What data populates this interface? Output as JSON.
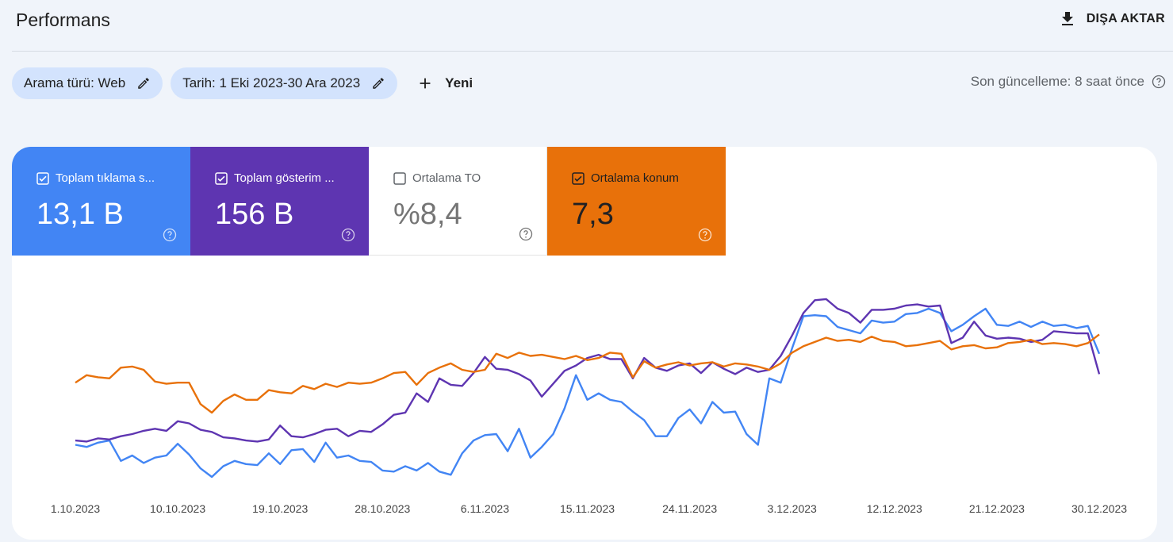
{
  "header": {
    "title": "Performans",
    "export_label": "DIŞA AKTAR"
  },
  "filters": {
    "search_type": "Arama türü: Web",
    "date": "Tarih: 1 Eki 2023-30 Ara 2023",
    "new_label": "Yeni",
    "last_update": "Son güncelleme: 8 saat önce"
  },
  "metrics": [
    {
      "label": "Toplam tıklama s...",
      "value": "13,1 B",
      "checked": true,
      "color": "#4285f4"
    },
    {
      "label": "Toplam gösterim ...",
      "value": "156 B",
      "checked": true,
      "color": "#5e35b1"
    },
    {
      "label": "Ortalama TO",
      "value": "%8,4",
      "checked": false,
      "color": "#ffffff"
    },
    {
      "label": "Ortalama konum",
      "value": "7,3",
      "checked": true,
      "color": "#e8710a"
    }
  ],
  "chart_data": {
    "type": "line",
    "x_tick_labels": [
      "1.10.2023",
      "10.10.2023",
      "19.10.2023",
      "28.10.2023",
      "6.11.2023",
      "15.11.2023",
      "24.11.2023",
      "3.12.2023",
      "12.12.2023",
      "21.12.2023",
      "30.12.2023"
    ],
    "x_count": 91,
    "y_axis_shown": false,
    "note_relative": "Series values are relative levels (0–1) read from the unlabelled chart; no y-axis is shown.",
    "series": [
      {
        "name": "Toplam tıklama sayısı",
        "color": "#4285f4",
        "values": [
          0.3,
          0.28,
          0.32,
          0.34,
          0.15,
          0.2,
          0.13,
          0.18,
          0.2,
          0.31,
          0.21,
          0.08,
          0.0,
          0.1,
          0.15,
          0.12,
          0.11,
          0.22,
          0.12,
          0.25,
          0.26,
          0.14,
          0.32,
          0.18,
          0.2,
          0.15,
          0.14,
          0.06,
          0.05,
          0.1,
          0.06,
          0.13,
          0.05,
          0.02,
          0.22,
          0.34,
          0.39,
          0.4,
          0.24,
          0.45,
          0.18,
          0.28,
          0.4,
          0.64,
          0.95,
          0.72,
          0.78,
          0.72,
          0.7,
          0.61,
          0.53,
          0.38,
          0.38,
          0.55,
          0.63,
          0.5,
          0.7,
          0.6,
          0.61,
          0.4,
          0.3,
          0.92,
          0.88,
          1.2,
          1.5,
          1.51,
          1.5,
          1.4,
          1.37,
          1.34,
          1.46,
          1.44,
          1.45,
          1.52,
          1.53,
          1.57,
          1.53,
          1.36,
          1.42,
          1.5,
          1.57,
          1.42,
          1.41,
          1.45,
          1.4,
          1.45,
          1.41,
          1.42,
          1.39,
          1.41,
          1.15
        ]
      },
      {
        "name": "Toplam gösterim sayısı",
        "color": "#5e35b1",
        "values": [
          0.34,
          0.33,
          0.36,
          0.35,
          0.38,
          0.4,
          0.43,
          0.45,
          0.43,
          0.52,
          0.5,
          0.44,
          0.42,
          0.37,
          0.36,
          0.34,
          0.33,
          0.35,
          0.48,
          0.38,
          0.37,
          0.4,
          0.44,
          0.45,
          0.38,
          0.43,
          0.42,
          0.49,
          0.58,
          0.6,
          0.78,
          0.7,
          0.92,
          0.86,
          0.85,
          0.97,
          1.12,
          1.01,
          1.0,
          0.96,
          0.9,
          0.75,
          0.87,
          0.99,
          1.04,
          1.11,
          1.14,
          1.1,
          1.1,
          0.92,
          1.11,
          1.02,
          0.99,
          1.04,
          1.06,
          0.97,
          1.07,
          1.01,
          0.96,
          1.02,
          0.98,
          1.0,
          1.13,
          1.32,
          1.53,
          1.65,
          1.66,
          1.57,
          1.53,
          1.44,
          1.56,
          1.56,
          1.57,
          1.6,
          1.61,
          1.59,
          1.6,
          1.25,
          1.3,
          1.45,
          1.32,
          1.29,
          1.3,
          1.29,
          1.26,
          1.28,
          1.36,
          1.35,
          1.34,
          1.34,
          0.96
        ]
      },
      {
        "name": "Ortalama konum",
        "color": "#e8710a",
        "values": [
          0.88,
          0.95,
          0.93,
          0.92,
          1.02,
          1.03,
          1.0,
          0.89,
          0.87,
          0.88,
          0.88,
          0.68,
          0.6,
          0.71,
          0.77,
          0.72,
          0.72,
          0.81,
          0.79,
          0.78,
          0.85,
          0.82,
          0.87,
          0.84,
          0.88,
          0.87,
          0.88,
          0.92,
          0.97,
          0.98,
          0.86,
          0.97,
          1.02,
          1.06,
          1.0,
          0.98,
          1.0,
          1.15,
          1.11,
          1.16,
          1.13,
          1.14,
          1.12,
          1.1,
          1.13,
          1.09,
          1.11,
          1.16,
          1.15,
          0.93,
          1.08,
          1.02,
          1.05,
          1.07,
          1.04,
          1.06,
          1.07,
          1.03,
          1.06,
          1.05,
          1.03,
          1.0,
          1.06,
          1.16,
          1.22,
          1.26,
          1.3,
          1.27,
          1.28,
          1.26,
          1.31,
          1.27,
          1.26,
          1.22,
          1.23,
          1.25,
          1.27,
          1.19,
          1.22,
          1.23,
          1.2,
          1.21,
          1.25,
          1.26,
          1.28,
          1.24,
          1.25,
          1.24,
          1.22,
          1.25,
          1.33
        ]
      }
    ]
  }
}
